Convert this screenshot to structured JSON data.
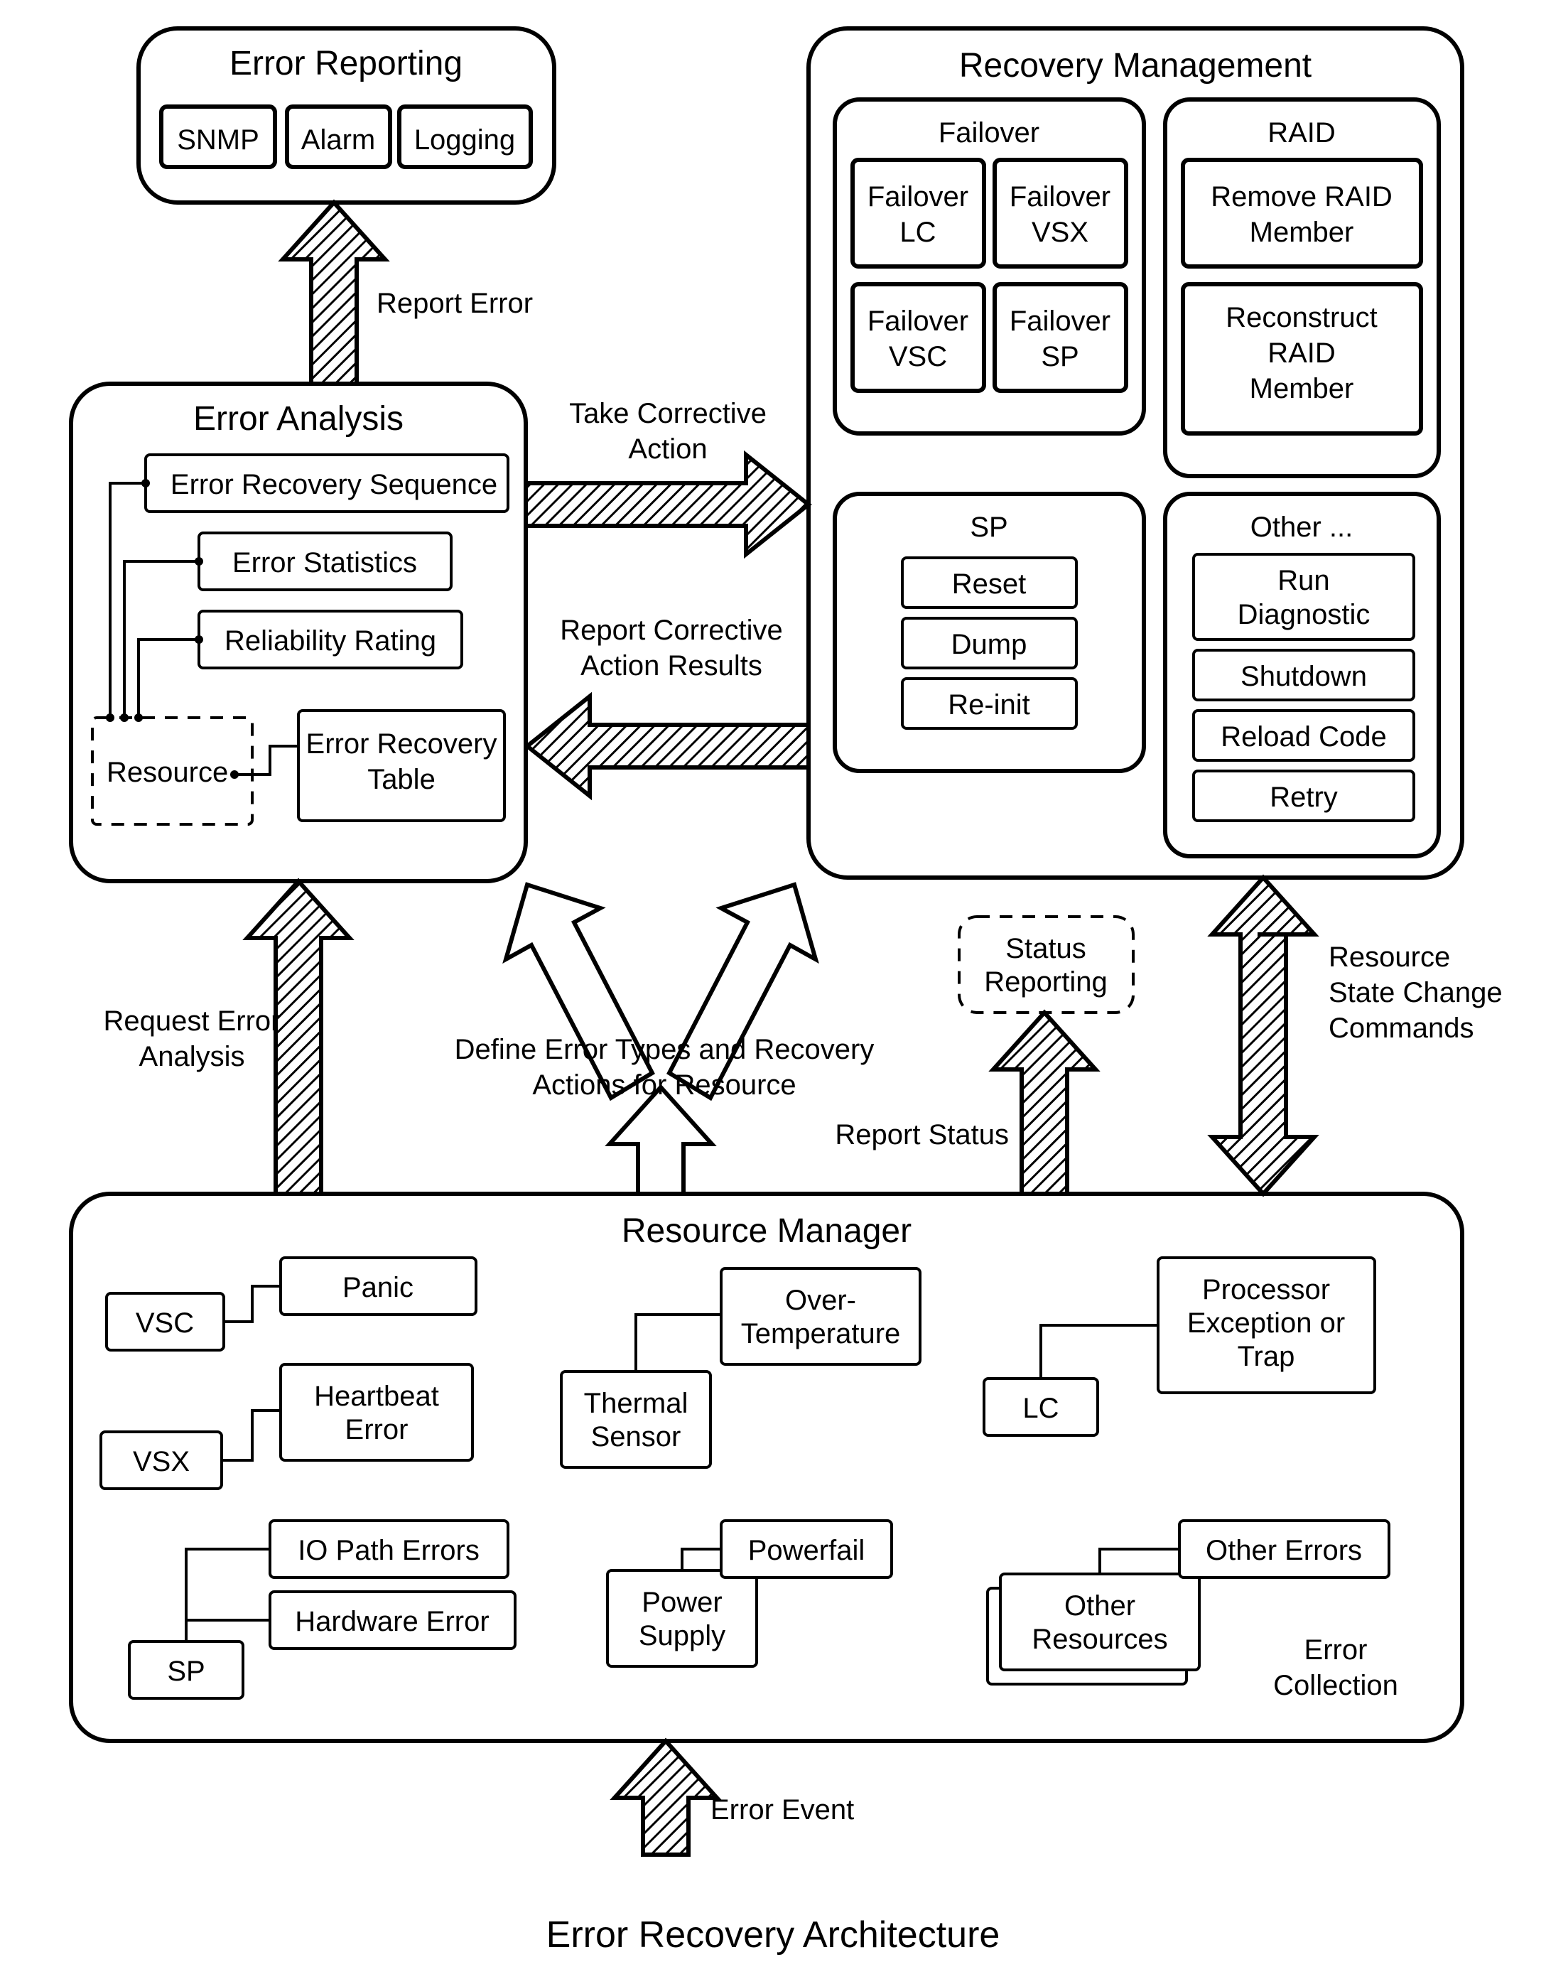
{
  "caption": "Error Recovery Architecture",
  "error_reporting": {
    "title": "Error Reporting",
    "items": [
      "SNMP",
      "Alarm",
      "Logging"
    ]
  },
  "error_analysis": {
    "title": "Error Analysis",
    "items": [
      "Error Recovery Sequence",
      "Error Statistics",
      "Reliability Rating"
    ],
    "resource": "Resource",
    "table": "Error Recovery\nTable"
  },
  "recovery_management": {
    "title": "Recovery Management",
    "failover": {
      "title": "Failover",
      "items": [
        "Failover\nLC",
        "Failover\nVSX",
        "Failover\nVSC",
        "Failover\nSP"
      ]
    },
    "raid": {
      "title": "RAID",
      "items": [
        "Remove RAID\nMember",
        "Reconstruct\nRAID\nMember"
      ]
    },
    "sp": {
      "title": "SP",
      "items": [
        "Reset",
        "Dump",
        "Re-init"
      ]
    },
    "other": {
      "title": "Other ...",
      "items": [
        "Run\nDiagnostic",
        "Shutdown",
        "Reload Code",
        "Retry"
      ]
    }
  },
  "resource_manager": {
    "title": "Resource Manager",
    "vsc": "VSC",
    "panic": "Panic",
    "vsx": "VSX",
    "heartbeat": "Heartbeat\nError",
    "sp": "SP",
    "io_path": "IO Path Errors",
    "hw_error": "Hardware Error",
    "thermal": "Thermal\nSensor",
    "over_temp": "Over-\nTemperature",
    "power_supply": "Power\nSupply",
    "powerfail": "Powerfail",
    "lc": "LC",
    "proc_exception": "Processor\nException or\nTrap",
    "other_res": "Other\nResources",
    "other_err": "Other Errors",
    "error_collection": "Error\nCollection"
  },
  "arrows": {
    "report_error": "Report Error",
    "take_action": "Take Corrective\nAction",
    "report_results": "Report Corrective\nAction Results",
    "request_analysis": "Request Error\nAnalysis",
    "define_types": "Define Error Types and Recovery\nActions for Resource",
    "status_reporting": "Status\nReporting",
    "report_status": "Report Status",
    "state_change": "Resource\nState Change\nCommands",
    "error_event": "Error Event"
  }
}
